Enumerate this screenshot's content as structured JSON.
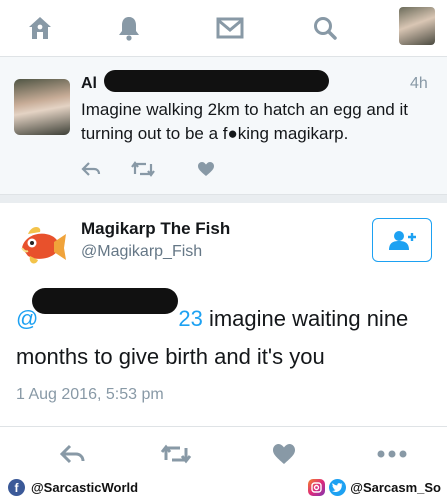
{
  "nav": {
    "icons": [
      "home-icon",
      "notifications-bell-icon",
      "messages-envelope-icon",
      "search-icon",
      "profile-avatar"
    ]
  },
  "reply_tweet": {
    "author_name_visible": "Al",
    "time": "4h",
    "text": "Imagine walking 2km to hatch an egg and it turning out to be a f●king magikarp."
  },
  "main_tweet": {
    "author_name": "Magikarp The Fish",
    "author_handle": "@Magikarp_Fish",
    "mention_visible": "@",
    "mention_suffix": "23",
    "text": " imagine waiting nine months to give birth and it's you",
    "date": "1 Aug 2016, 5:53 pm"
  },
  "footer": {
    "left_handle": "@SarcasticWorld",
    "right_handle": "@Sarcasm_So"
  },
  "colors": {
    "accent": "#1da1f2",
    "icon_gray": "#8899a6",
    "text": "#14171a"
  }
}
